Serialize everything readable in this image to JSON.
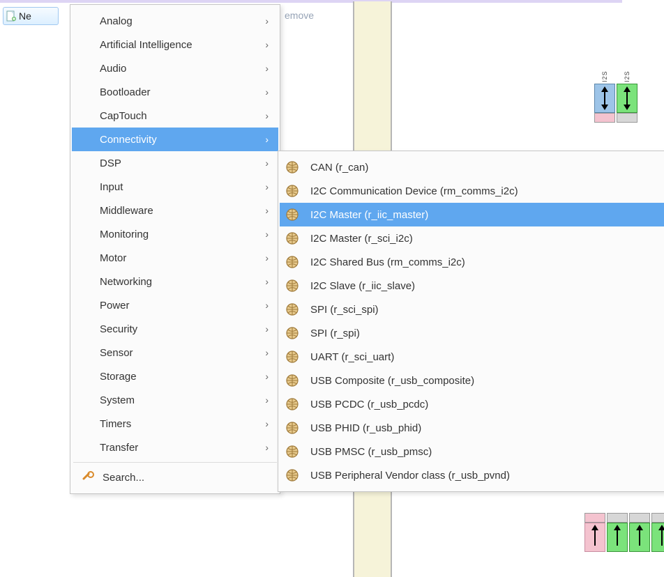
{
  "toolbar": {
    "new_label": "Ne",
    "remove_label": "emove"
  },
  "menu1": {
    "items": [
      {
        "label": "Analog"
      },
      {
        "label": "Artificial Intelligence"
      },
      {
        "label": "Audio"
      },
      {
        "label": "Bootloader"
      },
      {
        "label": "CapTouch"
      },
      {
        "label": "Connectivity"
      },
      {
        "label": "DSP"
      },
      {
        "label": "Input"
      },
      {
        "label": "Middleware"
      },
      {
        "label": "Monitoring"
      },
      {
        "label": "Motor"
      },
      {
        "label": "Networking"
      },
      {
        "label": "Power"
      },
      {
        "label": "Security"
      },
      {
        "label": "Sensor"
      },
      {
        "label": "Storage"
      },
      {
        "label": "System"
      },
      {
        "label": "Timers"
      },
      {
        "label": "Transfer"
      }
    ],
    "highlight_index": 5,
    "search_label": "Search..."
  },
  "menu2": {
    "items": [
      {
        "label": "CAN (r_can)"
      },
      {
        "label": "I2C Communication Device (rm_comms_i2c)"
      },
      {
        "label": "I2C Master (r_iic_master)"
      },
      {
        "label": "I2C Master (r_sci_i2c)"
      },
      {
        "label": "I2C Shared Bus (rm_comms_i2c)"
      },
      {
        "label": "I2C Slave (r_iic_slave)"
      },
      {
        "label": "SPI (r_sci_spi)"
      },
      {
        "label": "SPI (r_spi)"
      },
      {
        "label": "UART (r_sci_uart)"
      },
      {
        "label": "USB Composite (r_usb_composite)"
      },
      {
        "label": "USB PCDC (r_usb_pcdc)"
      },
      {
        "label": "USB PHID (r_usb_phid)"
      },
      {
        "label": "USB PMSC (r_usb_pmsc)"
      },
      {
        "label": "USB Peripheral Vendor class (r_usb_pvnd)"
      }
    ],
    "highlight_index": 2
  },
  "bg_pins": {
    "top": [
      {
        "label": "I2S",
        "body": "blue",
        "arrow": "double",
        "foot": ""
      },
      {
        "label": "I2S",
        "body": "green",
        "arrow": "double",
        "foot": "grey"
      }
    ],
    "bottom": [
      {
        "label": "",
        "body": "pink",
        "arrow": "up",
        "foot": ""
      },
      {
        "label": "",
        "body": "green",
        "arrow": "up",
        "foot": ""
      },
      {
        "label": "",
        "body": "green",
        "arrow": "up",
        "foot": ""
      },
      {
        "label": "",
        "body": "green",
        "arrow": "up",
        "foot": ""
      }
    ]
  }
}
